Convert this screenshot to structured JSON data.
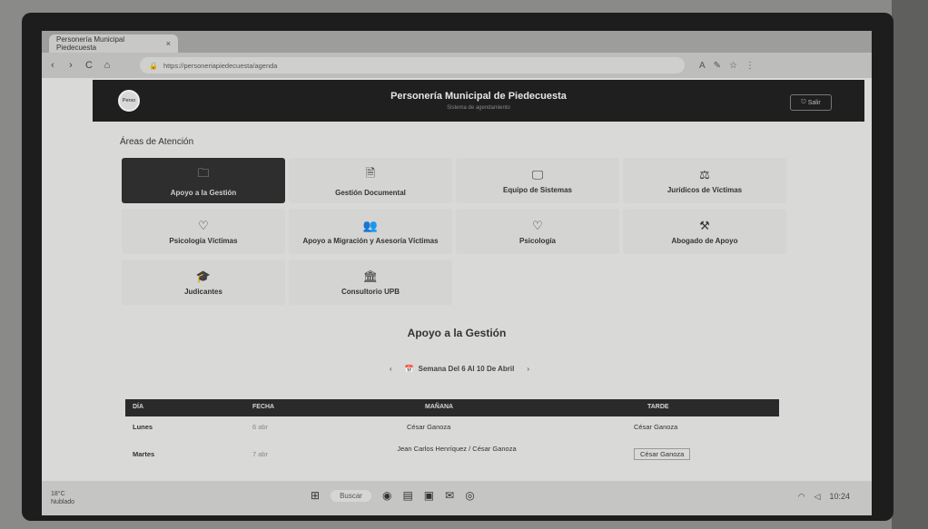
{
  "browser": {
    "tab_title": "Personería Municipal Piedecuesta",
    "tab_close": "×",
    "url": "https://personeriapiedecuesta/agenda",
    "nav": {
      "back": "‹",
      "forward": "›",
      "reload": "C",
      "home": "⌂"
    },
    "ext_icons": [
      "A",
      "✎",
      "☆",
      "⋮"
    ]
  },
  "app": {
    "logo_text": "Perso",
    "title": "Personería Municipal de Piedecuesta",
    "subtitle": "Sistema de agendamiento",
    "exit_label": "Salir"
  },
  "areas": {
    "heading": "Áreas de Atención",
    "items": [
      {
        "label": "Apoyo a la Gestión",
        "icon": "briefcase-icon",
        "glyph": "🗀",
        "active": true
      },
      {
        "label": "Gestión Documental",
        "icon": "document-icon",
        "glyph": "🗎",
        "active": false
      },
      {
        "label": "Equipo de Sistemas",
        "icon": "monitor-icon",
        "glyph": "🖵",
        "active": false
      },
      {
        "label": "Jurídicos de Víctimas",
        "icon": "scale-icon",
        "glyph": "⚖",
        "active": false
      },
      {
        "label": "Psicología Víctimas",
        "icon": "heart-pulse-icon",
        "glyph": "♡",
        "active": false
      },
      {
        "label": "Apoyo a Migración y Asesoría Víctimas",
        "icon": "users-icon",
        "glyph": "👥",
        "active": false
      },
      {
        "label": "Psicología",
        "icon": "heart-icon",
        "glyph": "♡",
        "active": false
      },
      {
        "label": "Abogado de Apoyo",
        "icon": "gavel-icon",
        "glyph": "⚒",
        "active": false
      },
      {
        "label": "Judicantes",
        "icon": "graduation-cap-icon",
        "glyph": "🎓",
        "active": false
      },
      {
        "label": "Consultorio UPB",
        "icon": "building-icon",
        "glyph": "🏛",
        "active": false
      }
    ]
  },
  "schedule": {
    "title": "Apoyo a la Gestión",
    "week_label": "Semana Del 6 Al 10 De Abril",
    "prev": "‹",
    "next": "›",
    "columns": [
      "DÍA",
      "FECHA",
      "MAÑANA",
      "TARDE"
    ],
    "rows": [
      {
        "day": "Lunes",
        "date": "6 abr",
        "morning": "César Ganoza",
        "afternoon": "César Ganoza"
      },
      {
        "day": "Martes",
        "date": "7 abr",
        "morning": "Jean Carlos Henríquez / César Ganoza",
        "afternoon": "César Ganoza"
      }
    ]
  },
  "taskbar": {
    "weather_temp": "18°C",
    "weather_desc": "Nublado",
    "search_placeholder": "Buscar",
    "time": "10:24"
  }
}
